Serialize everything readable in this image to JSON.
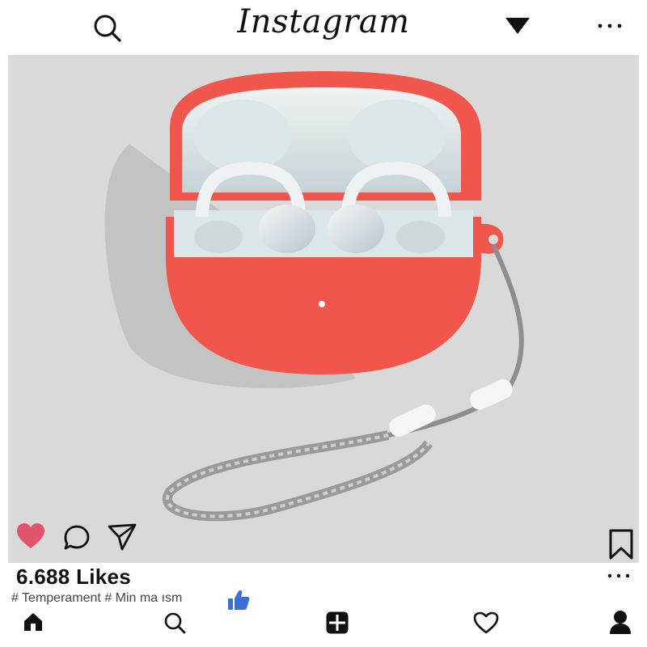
{
  "header": {
    "logo_text": "Instagram",
    "icons": [
      "search-icon",
      "caret-down-icon",
      "more-icon"
    ]
  },
  "post": {
    "likes_text": "6.688 Likes",
    "caption_tags": "# Temperament # Min ma ısm",
    "liked": true,
    "like_color": "#e0556a",
    "thumb_color": "#3b6fd6",
    "actions": [
      "heart-icon",
      "comment-icon",
      "share-icon",
      "bookmark-icon"
    ],
    "image_subject": "coral earbud case with lanyard"
  },
  "bottom_nav": {
    "items": [
      "home-icon",
      "search-icon",
      "add-post-icon",
      "activity-heart-icon",
      "profile-icon"
    ]
  }
}
